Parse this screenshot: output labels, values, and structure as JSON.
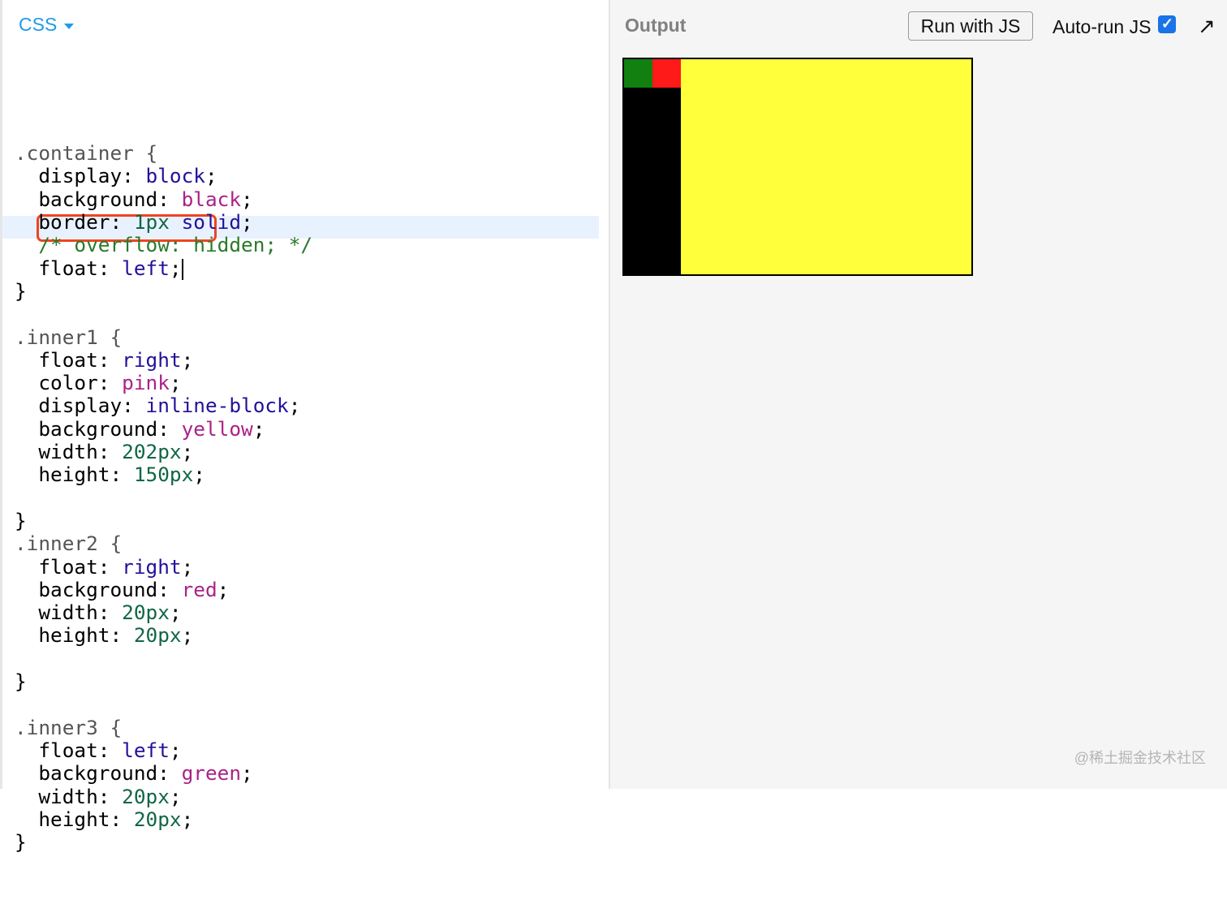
{
  "editor": {
    "language": "CSS",
    "lines": [
      [
        [
          ".container {",
          "sel"
        ]
      ],
      [
        [
          "  display: ",
          "prop"
        ],
        [
          "block",
          "kw"
        ],
        [
          ";",
          "p"
        ]
      ],
      [
        [
          "  background: ",
          "prop"
        ],
        [
          "black",
          "col"
        ],
        [
          ";",
          "p"
        ]
      ],
      [
        [
          "  border: ",
          "prop"
        ],
        [
          "1px",
          "num"
        ],
        [
          " ",
          "p"
        ],
        [
          "solid",
          "kw"
        ],
        [
          ";",
          "p"
        ]
      ],
      [
        [
          "  /* overflow: hidden; */",
          "com"
        ]
      ],
      [
        [
          "  float: ",
          "prop"
        ],
        [
          "left",
          "kw"
        ],
        [
          ";",
          "p"
        ]
      ],
      [
        [
          "}",
          "p"
        ]
      ],
      [],
      [
        [
          ".inner1 {",
          "sel"
        ]
      ],
      [
        [
          "  float: ",
          "prop"
        ],
        [
          "right",
          "kw"
        ],
        [
          ";",
          "p"
        ]
      ],
      [
        [
          "  color: ",
          "prop"
        ],
        [
          "pink",
          "col"
        ],
        [
          ";",
          "p"
        ]
      ],
      [
        [
          "  display: ",
          "prop"
        ],
        [
          "inline-block",
          "kw"
        ],
        [
          ";",
          "p"
        ]
      ],
      [
        [
          "  background: ",
          "prop"
        ],
        [
          "yellow",
          "col"
        ],
        [
          ";",
          "p"
        ]
      ],
      [
        [
          "  width: ",
          "prop"
        ],
        [
          "202px",
          "num"
        ],
        [
          ";",
          "p"
        ]
      ],
      [
        [
          "  height: ",
          "prop"
        ],
        [
          "150px",
          "num"
        ],
        [
          ";",
          "p"
        ]
      ],
      [],
      [
        [
          "}",
          "p"
        ]
      ],
      [
        [
          ".inner2 {",
          "sel"
        ]
      ],
      [
        [
          "  float: ",
          "prop"
        ],
        [
          "right",
          "kw"
        ],
        [
          ";",
          "p"
        ]
      ],
      [
        [
          "  background: ",
          "prop"
        ],
        [
          "red",
          "col"
        ],
        [
          ";",
          "p"
        ]
      ],
      [
        [
          "  width: ",
          "prop"
        ],
        [
          "20px",
          "num"
        ],
        [
          ";",
          "p"
        ]
      ],
      [
        [
          "  height: ",
          "prop"
        ],
        [
          "20px",
          "num"
        ],
        [
          ";",
          "p"
        ]
      ],
      [],
      [
        [
          "}",
          "p"
        ]
      ],
      [],
      [
        [
          ".inner3 {",
          "sel"
        ]
      ],
      [
        [
          "  float: ",
          "prop"
        ],
        [
          "left",
          "kw"
        ],
        [
          ";",
          "p"
        ]
      ],
      [
        [
          "  background: ",
          "prop"
        ],
        [
          "green",
          "col"
        ],
        [
          ";",
          "p"
        ]
      ],
      [
        [
          "  width: ",
          "prop"
        ],
        [
          "20px",
          "num"
        ],
        [
          ";",
          "p"
        ]
      ],
      [
        [
          "  height: ",
          "prop"
        ],
        [
          "20px",
          "num"
        ],
        [
          ";",
          "p"
        ]
      ],
      [
        [
          "}",
          "p"
        ]
      ]
    ]
  },
  "output": {
    "title": "Output",
    "run_label": "Run with JS",
    "autorun_label": "Auto-run JS",
    "autorun_checked": true
  },
  "watermark": "@稀土掘金技术社区"
}
